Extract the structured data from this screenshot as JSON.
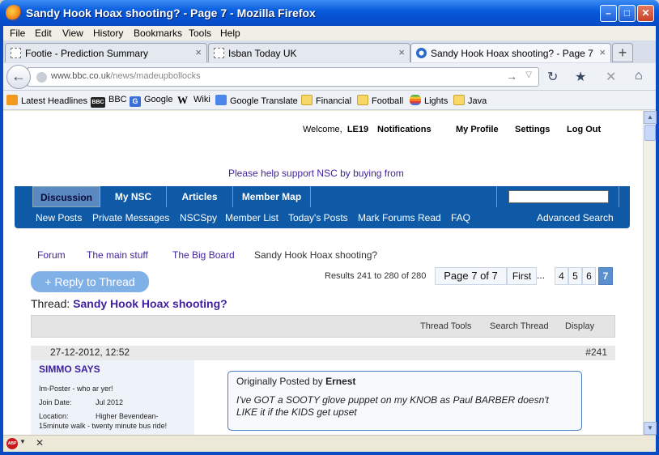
{
  "window": {
    "title": "Sandy Hook Hoax shooting? - Page 7 - Mozilla Firefox"
  },
  "menu": [
    "File",
    "Edit",
    "View",
    "History",
    "Bookmarks",
    "Tools",
    "Help"
  ],
  "tabs": [
    {
      "label": "Footie - Prediction Summary",
      "active": false
    },
    {
      "label": "Isban Today UK",
      "active": false
    },
    {
      "label": "Sandy Hook Hoax shooting? - Page 7",
      "active": true
    }
  ],
  "newtab_label": "+",
  "url": {
    "host": "www.bbc.co.uk",
    "path": "/news/madeupbollocks"
  },
  "bookmarks": [
    "Latest Headlines",
    "BBC",
    "Google",
    "Wiki",
    "Google Translate",
    "Financial",
    "Football",
    "Lights",
    "Java"
  ],
  "bookmark_icon_text": {
    "bbc": "BBC",
    "google": "G",
    "wiki": "W"
  },
  "header": {
    "welcome": "Welcome,",
    "username": "LE19",
    "links": [
      "Notifications",
      "My Profile",
      "Settings",
      "Log Out"
    ]
  },
  "support_text": "Please help support NSC by buying from",
  "main_nav": [
    "Discussion",
    "My NSC",
    "Articles",
    "Member Map"
  ],
  "sub_nav": [
    "New Posts",
    "Private Messages",
    "NSCSpy",
    "Member List",
    "Today's Posts",
    "Mark Forums Read",
    "FAQ"
  ],
  "advanced_search": "Advanced Search",
  "breadcrumb": [
    "Forum",
    "The main stuff",
    "The Big Board",
    "Sandy Hook Hoax shooting?"
  ],
  "reply_button": "+ Reply to Thread",
  "results": "Results 241 to 280 of 280",
  "pagination": {
    "label": "Page 7 of 7",
    "first": "First",
    "ellipsis": "...",
    "pages": [
      "4",
      "5",
      "6",
      "7"
    ],
    "current": "7"
  },
  "thread": {
    "prefix": "Thread:",
    "title": "Sandy Hook Hoax shooting?"
  },
  "thread_tools": [
    "Thread Tools",
    "Search Thread",
    "Display"
  ],
  "post": {
    "date": "27-12-2012, 12:52",
    "number": "#241",
    "user": {
      "name": "SIMMO SAYS",
      "title": "Im-Poster - who ar yer!",
      "join_label": "Join Date:",
      "join_date": "Jul 2012",
      "location_label": "Location:",
      "location": "Higher Bevendean-",
      "location2": "15minute walk - twenty minute bus ride!"
    },
    "quote": {
      "intro": "Originally Posted by",
      "author": "Ernest",
      "text": "I've GOT a SOOTY glove puppet on my KNOB as Paul BARBER doesn't LIKE it if the KIDS get upset"
    }
  },
  "statusbar": {
    "adblock": "ABP"
  }
}
